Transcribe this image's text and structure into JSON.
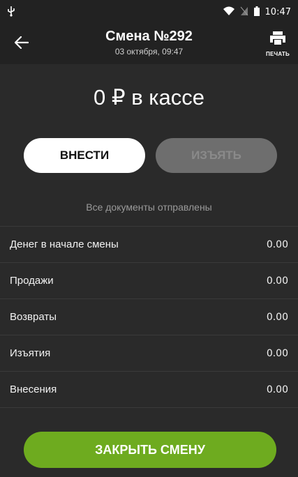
{
  "status_bar": {
    "left_icon": "usb-icon",
    "icons": [
      "wifi-icon",
      "no-sim-icon",
      "battery-icon"
    ],
    "time": "10:47"
  },
  "header": {
    "title": "Смена №292",
    "subtitle": "03 октября, 09:47",
    "print_label": "ПЕЧАТЬ"
  },
  "cash": {
    "text": "0 ₽ в кассе"
  },
  "actions": {
    "deposit_label": "ВНЕСТИ",
    "withdraw_label": "ИЗЪЯТЬ"
  },
  "docs_status": "Все документы отправлены",
  "rows": [
    {
      "label": "Денег в начале смены",
      "value": "0.00"
    },
    {
      "label": "Продажи",
      "value": "0.00"
    },
    {
      "label": "Возвраты",
      "value": "0.00"
    },
    {
      "label": "Изъятия",
      "value": "0.00"
    },
    {
      "label": "Внесения",
      "value": "0.00"
    }
  ],
  "close_label": "ЗАКРЫТЬ СМЕНУ",
  "colors": {
    "background": "#2a2a2a",
    "bar": "#222222",
    "accent_green": "#6eab1f",
    "disabled": "#6e6e6e"
  }
}
